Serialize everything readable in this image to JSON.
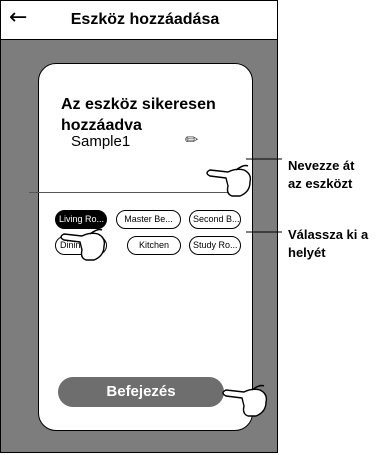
{
  "header": {
    "back_icon": "arrow-left-icon",
    "title": "Eszköz hozzáadása"
  },
  "card": {
    "success_text": "Az eszköz sikeresen hozzáadva",
    "device_name": "Sample1",
    "edit_icon": "pencil-icon"
  },
  "rooms": [
    {
      "label": "Living Ro...",
      "selected": true
    },
    {
      "label": "Master Be...",
      "selected": false
    },
    {
      "label": "Second B...",
      "selected": false
    },
    {
      "label": "Dining R...",
      "selected": false
    },
    {
      "label": "Kitchen",
      "selected": false
    },
    {
      "label": "Study Ro...",
      "selected": false
    }
  ],
  "finish_button": "Befejezés",
  "annotations": {
    "rename_line1": "Nevezze át",
    "rename_line2": "az eszközt",
    "location_line1": "Válassza ki a",
    "location_line2": "helyét"
  },
  "colors": {
    "frame_gray": "#7d7d7d",
    "button_gray": "#6e6e6e",
    "selected_chip": "#000000"
  }
}
